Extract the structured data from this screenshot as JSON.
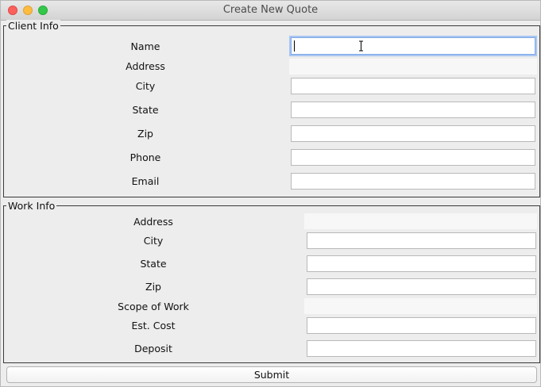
{
  "window": {
    "title": "Create New Quote"
  },
  "client_info": {
    "legend": "Client Info",
    "fields": [
      {
        "label": "Name"
      },
      {
        "label": "Address"
      },
      {
        "label": "City"
      },
      {
        "label": "State"
      },
      {
        "label": "Zip"
      },
      {
        "label": "Phone"
      },
      {
        "label": "Email"
      }
    ]
  },
  "work_info": {
    "legend": "Work Info",
    "fields": [
      {
        "label": "Address"
      },
      {
        "label": "City"
      },
      {
        "label": "State"
      },
      {
        "label": "Zip"
      },
      {
        "label": "Scope of Work"
      },
      {
        "label": "Est. Cost"
      },
      {
        "label": "Deposit"
      }
    ]
  },
  "actions": {
    "submit_label": "Submit"
  }
}
